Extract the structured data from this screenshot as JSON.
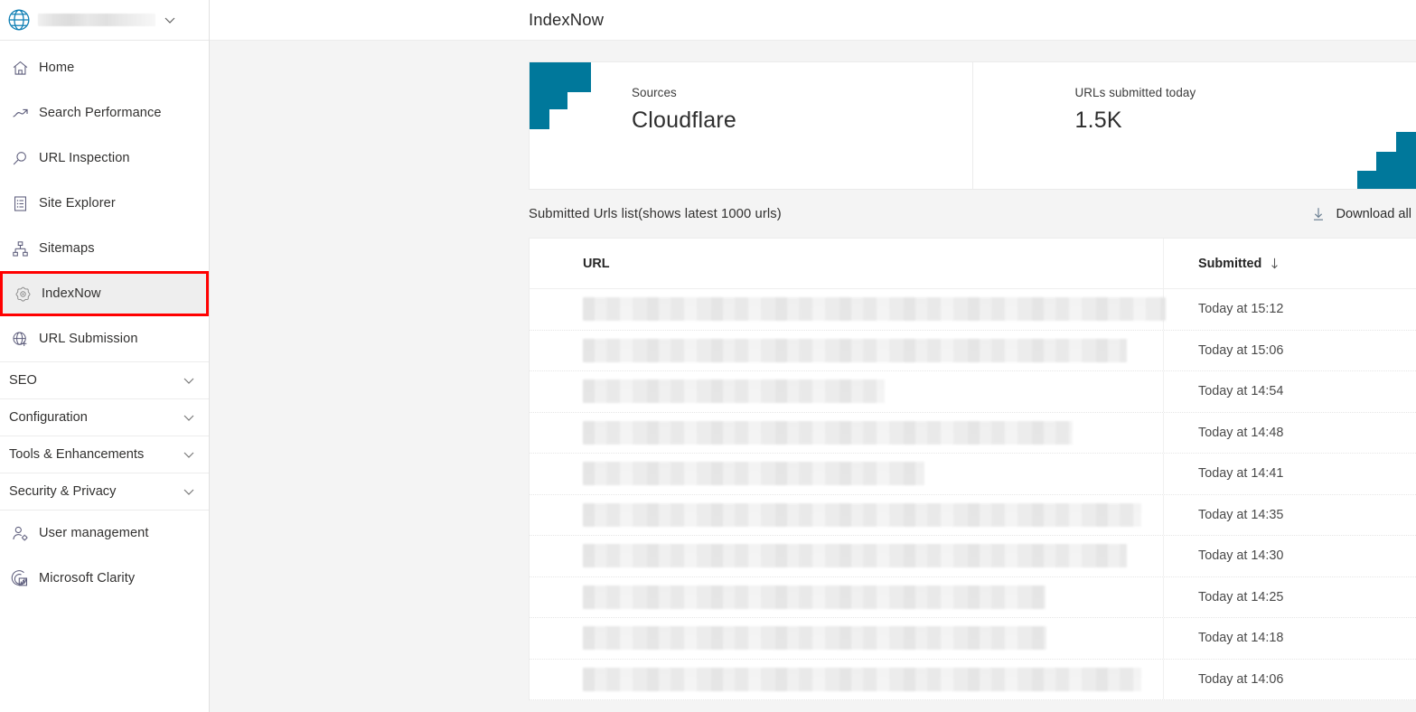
{
  "sidebar": {
    "site_selector": {
      "name": "site-picker",
      "icon": "globe-icon",
      "value_redacted": true,
      "chevron": "chevron-down-icon"
    },
    "items": [
      {
        "label": "Home",
        "icon": "home-icon"
      },
      {
        "label": "Search Performance",
        "icon": "trending-up-icon"
      },
      {
        "label": "URL Inspection",
        "icon": "magnifier-icon"
      },
      {
        "label": "Site Explorer",
        "icon": "document-list-icon"
      },
      {
        "label": "Sitemaps",
        "icon": "sitemap-icon"
      },
      {
        "label": "IndexNow",
        "icon": "indexnow-gear-icon",
        "selected": true,
        "highlight_color": "#ff0000"
      },
      {
        "label": "URL Submission",
        "icon": "globe-plus-icon"
      }
    ],
    "groups": [
      {
        "label": "SEO",
        "icon": "chevron-down-icon"
      },
      {
        "label": "Configuration",
        "icon": "chevron-down-icon"
      },
      {
        "label": "Tools & Enhancements",
        "icon": "chevron-down-icon"
      },
      {
        "label": "Security & Privacy",
        "icon": "chevron-down-icon"
      }
    ],
    "bottom_items": [
      {
        "label": "User management",
        "icon": "user-gear-icon"
      },
      {
        "label": "Microsoft Clarity",
        "icon": "clarity-chart-icon"
      }
    ]
  },
  "header": {
    "title": "IndexNow"
  },
  "cards": [
    {
      "label": "Sources",
      "value": "Cloudflare",
      "decoration": "steps-top-left",
      "accent": "#00789B"
    },
    {
      "label": "URLs submitted today",
      "value": "1.5K",
      "decoration": "steps-bottom-right",
      "accent": "#00789B"
    }
  ],
  "list": {
    "title": "Submitted Urls list(shows latest 1000 urls)",
    "download_label": "Download all",
    "download_icon": "download-arrow-icon",
    "columns": {
      "url": "URL",
      "submitted": "Submitted",
      "sort_icon": "sort-descending-arrow-icon"
    },
    "rows": [
      {
        "url_redacted_width": 645,
        "submitted": "Today at 15:12"
      },
      {
        "url_redacted_width": 602,
        "submitted": "Today at 15:06"
      },
      {
        "url_redacted_width": 334,
        "submitted": "Today at 14:54"
      },
      {
        "url_redacted_width": 542,
        "submitted": "Today at 14:48"
      },
      {
        "url_redacted_width": 378,
        "submitted": "Today at 14:41"
      },
      {
        "url_redacted_width": 618,
        "submitted": "Today at 14:35"
      },
      {
        "url_redacted_width": 602,
        "submitted": "Today at 14:30"
      },
      {
        "url_redacted_width": 512,
        "submitted": "Today at 14:25"
      },
      {
        "url_redacted_width": 513,
        "submitted": "Today at 14:18"
      },
      {
        "url_redacted_width": 618,
        "submitted": "Today at 14:06"
      }
    ]
  },
  "colors": {
    "accent_teal": "#00789B",
    "highlight_red": "#ff0000",
    "content_bg": "#f4f4f4",
    "text": "#323130"
  }
}
